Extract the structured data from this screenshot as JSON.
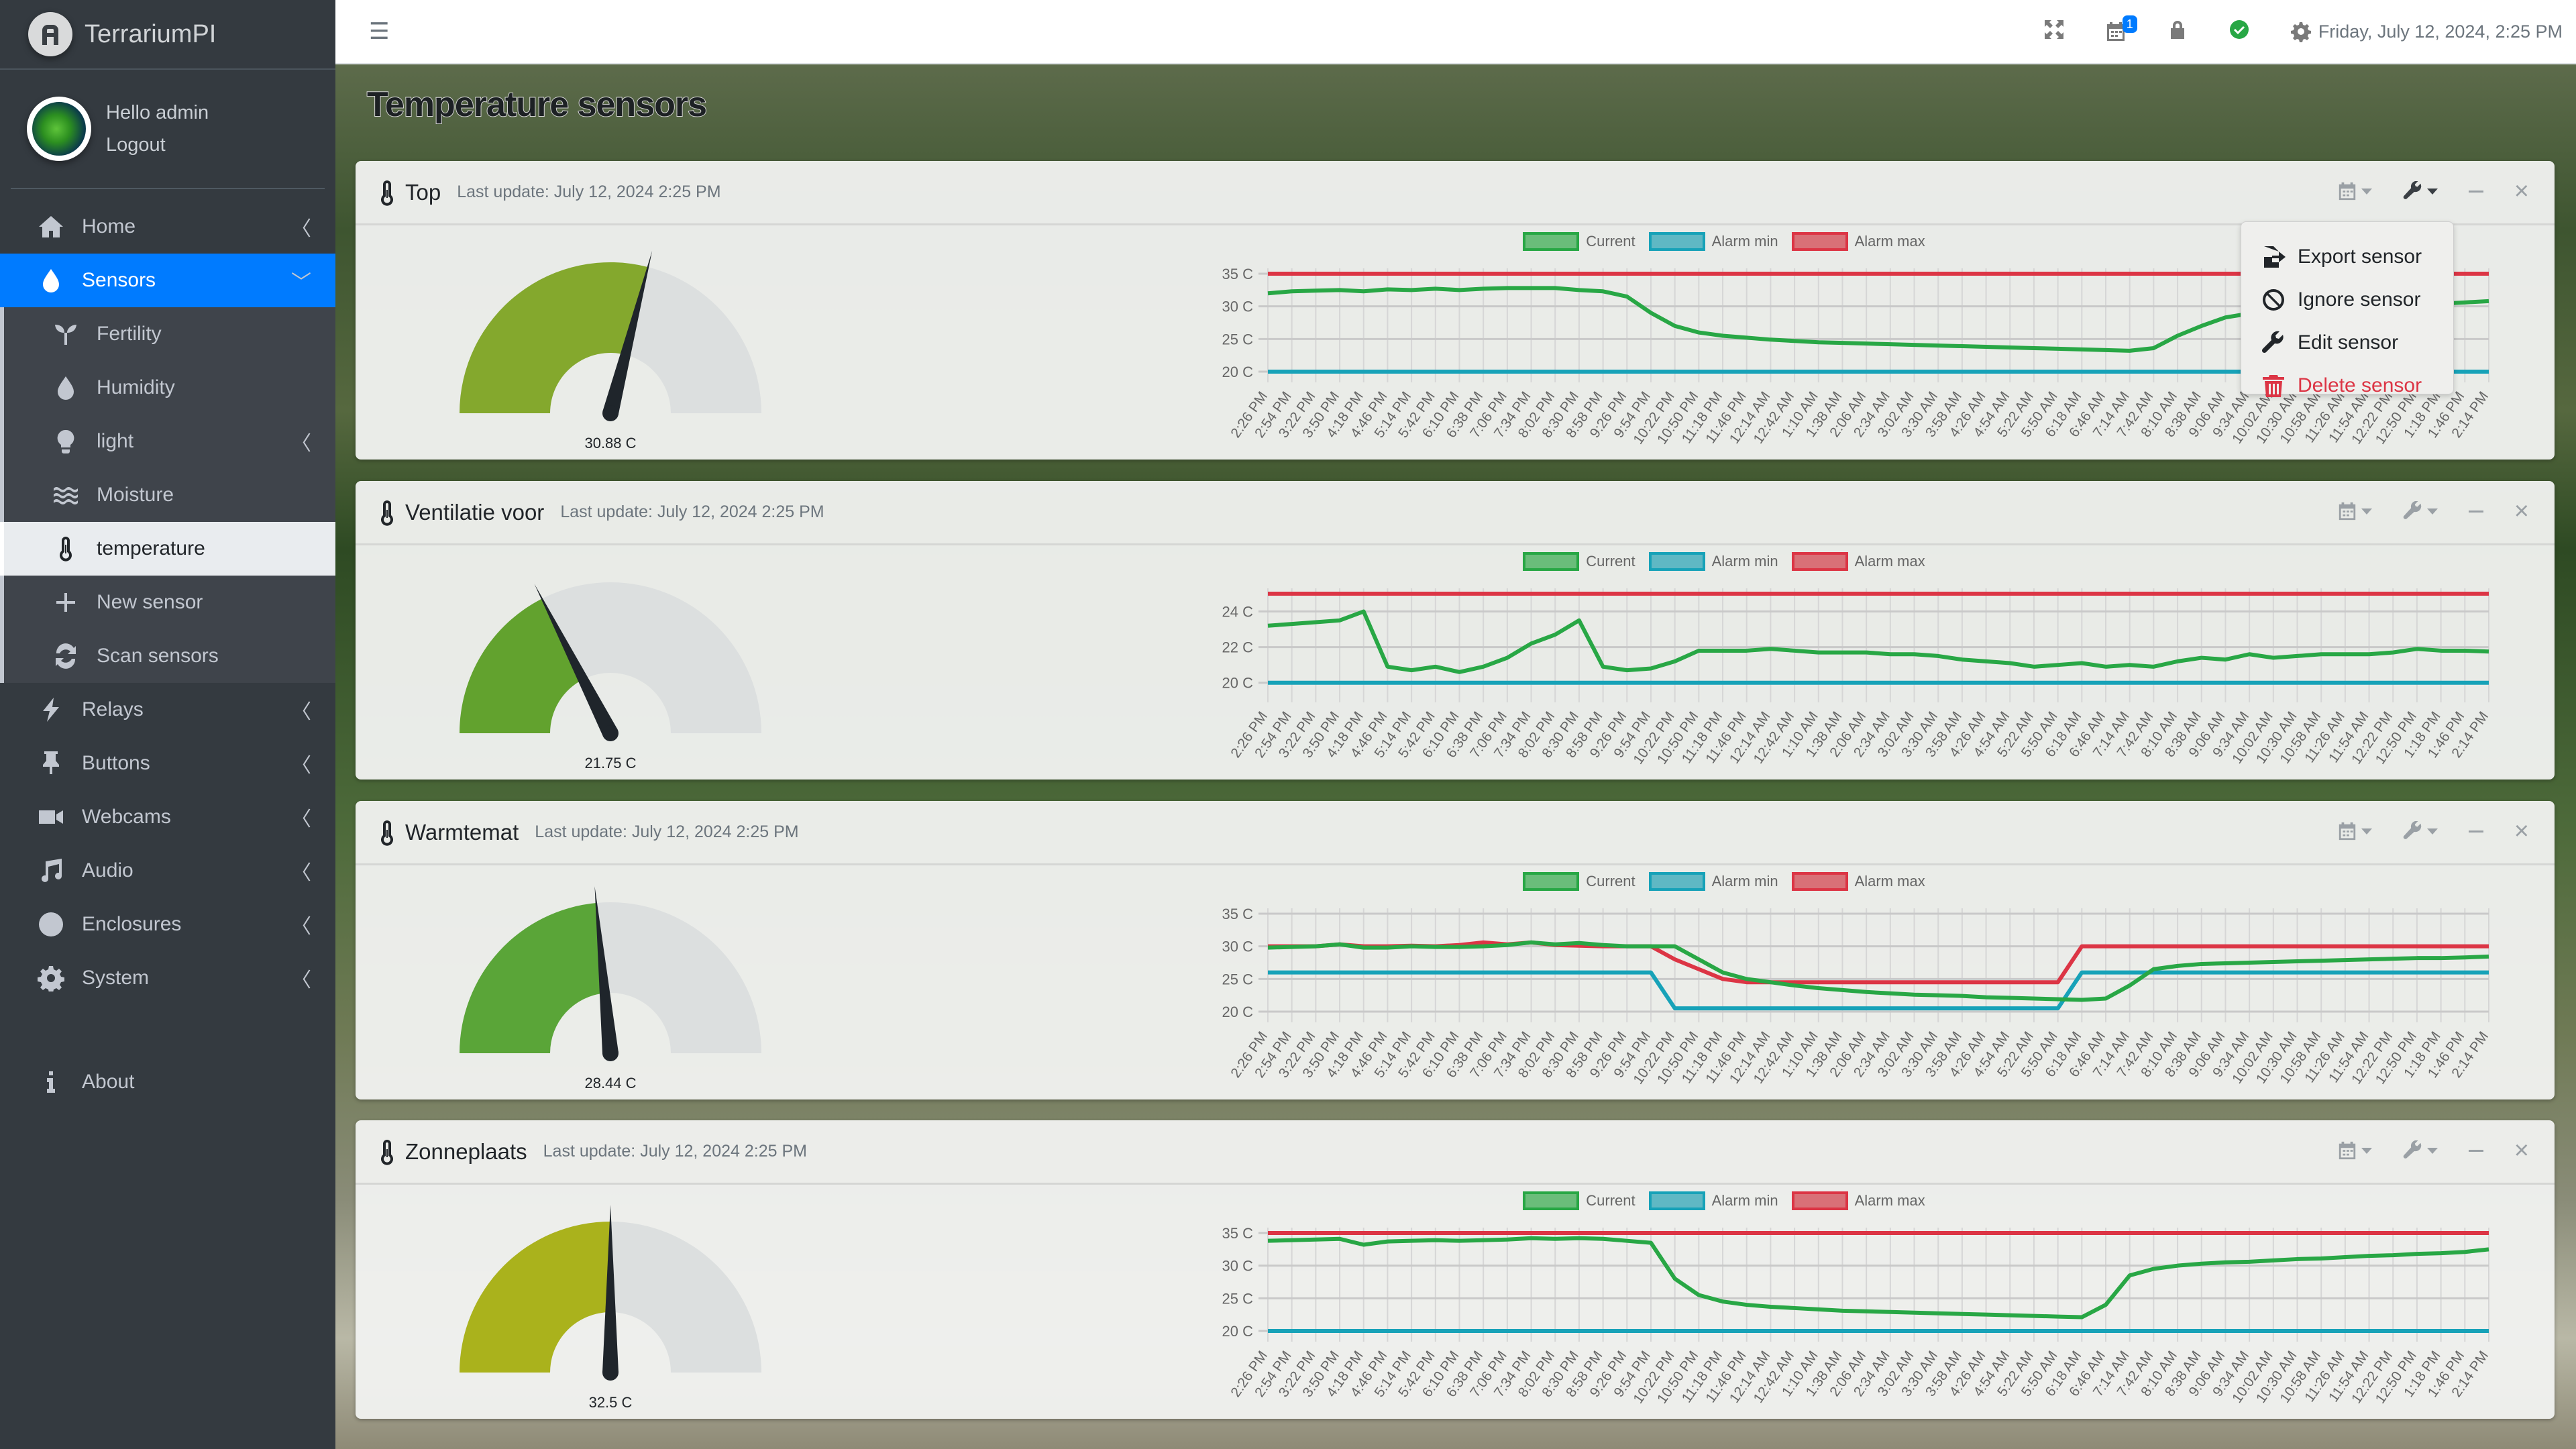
{
  "app": {
    "name": "TerrariumPI"
  },
  "user": {
    "greeting": "Hello admin",
    "logout": "Logout"
  },
  "sidebar": {
    "items": [
      {
        "label": "Home",
        "icon": "home-icon",
        "chevron": "‹"
      },
      {
        "label": "Sensors",
        "icon": "droplet-icon",
        "chevron": "⌄",
        "active": true
      },
      {
        "label": "Fertility",
        "icon": "seedling-icon",
        "sub": true
      },
      {
        "label": "Humidity",
        "icon": "droplet-icon",
        "sub": true
      },
      {
        "label": "light",
        "icon": "lightbulb-icon",
        "sub": true,
        "chevron": "‹"
      },
      {
        "label": "Moisture",
        "icon": "water-icon",
        "sub": true
      },
      {
        "label": "temperature",
        "icon": "thermometer-icon",
        "sub": true,
        "current": true
      },
      {
        "label": "New sensor",
        "icon": "plus-icon",
        "sub": true
      },
      {
        "label": "Scan sensors",
        "icon": "sync-icon",
        "sub": true
      },
      {
        "label": "Relays",
        "icon": "bolt-icon",
        "chevron": "‹"
      },
      {
        "label": "Buttons",
        "icon": "thumbtack-icon",
        "chevron": "‹"
      },
      {
        "label": "Webcams",
        "icon": "video-icon",
        "chevron": "‹"
      },
      {
        "label": "Audio",
        "icon": "music-icon",
        "chevron": "‹"
      },
      {
        "label": "Enclosures",
        "icon": "globe-icon",
        "chevron": "‹"
      },
      {
        "label": "System",
        "icon": "cog-icon",
        "chevron": "‹"
      },
      {
        "label": "About",
        "icon": "info-icon"
      }
    ]
  },
  "topbar": {
    "menu_icon": "bars-icon",
    "icons": [
      "expand-icon",
      "calendar-icon",
      "lock-icon",
      "check-circle-icon"
    ],
    "calendar_badge": "1",
    "datetime": "Friday, July 12, 2024, 2:25 PM"
  },
  "page": {
    "title": "Temperature sensors"
  },
  "legend": {
    "current": "Current",
    "alarm_min": "Alarm min",
    "alarm_max": "Alarm max"
  },
  "colors": {
    "current": "#28a745",
    "alarm_min": "#17a2b8",
    "alarm_max": "#dc3545",
    "sidebar_active": "#007bff"
  },
  "dropdown": {
    "items": [
      {
        "label": "Export sensor",
        "icon": "file-export-icon"
      },
      {
        "label": "Ignore sensor",
        "icon": "ban-icon"
      },
      {
        "label": "Edit sensor",
        "icon": "wrench-icon"
      },
      {
        "label": "Delete sensor",
        "icon": "trash-icon",
        "danger": true
      }
    ]
  },
  "x_labels": [
    "2:26 PM",
    "2:54 PM",
    "3:22 PM",
    "3:50 PM",
    "4:18 PM",
    "4:46 PM",
    "5:14 PM",
    "5:42 PM",
    "6:10 PM",
    "6:38 PM",
    "7:06 PM",
    "7:34 PM",
    "8:02 PM",
    "8:30 PM",
    "8:58 PM",
    "9:26 PM",
    "9:54 PM",
    "10:22 PM",
    "10:50 PM",
    "11:18 PM",
    "11:46 PM",
    "12:14 AM",
    "12:42 AM",
    "1:10 AM",
    "1:38 AM",
    "2:06 AM",
    "2:34 AM",
    "3:02 AM",
    "3:30 AM",
    "3:58 AM",
    "4:26 AM",
    "4:54 AM",
    "5:22 AM",
    "5:50 AM",
    "6:18 AM",
    "6:46 AM",
    "7:14 AM",
    "7:42 AM",
    "8:10 AM",
    "8:38 AM",
    "9:06 AM",
    "9:34 AM",
    "10:02 AM",
    "10:30 AM",
    "10:58 AM",
    "11:26 AM",
    "11:54 AM",
    "12:22 PM",
    "12:50 PM",
    "1:18 PM",
    "1:46 PM",
    "2:14 PM"
  ],
  "sensors": [
    {
      "name": "Top",
      "last_update": "Last update: July 12, 2024 2:25 PM",
      "value_label": "30.88 C",
      "gauge_fraction": 0.58,
      "gauge_color": "#84a82d",
      "y_ticks": [
        "35 C",
        "30 C",
        "25 C",
        "20 C"
      ],
      "y_range": [
        20,
        35
      ],
      "current": [
        32,
        32.3,
        32.4,
        32.5,
        32.3,
        32.6,
        32.5,
        32.7,
        32.5,
        32.7,
        32.8,
        32.8,
        32.8,
        32.5,
        32.3,
        31.5,
        29,
        27,
        26,
        25.5,
        25.2,
        24.9,
        24.7,
        24.5,
        24.4,
        24.3,
        24.2,
        24.1,
        24,
        23.9,
        23.8,
        23.7,
        23.6,
        23.5,
        23.4,
        23.3,
        23.2,
        23.6,
        25.5,
        27,
        28.3,
        28.9,
        29.3,
        29.5,
        29.7,
        29.8,
        30,
        30.2,
        30.3,
        30.4,
        30.6,
        30.8
      ],
      "alarm_min": 20,
      "alarm_max": 35,
      "show_menu": true
    },
    {
      "name": "Ventilatie voor",
      "last_update": "Last update: July 12, 2024 2:25 PM",
      "value_label": "21.75 C",
      "gauge_fraction": 0.35,
      "gauge_color": "#62a22e",
      "y_ticks": [
        "24 C",
        "22 C",
        "20 C"
      ],
      "y_range": [
        19.5,
        25
      ],
      "current": [
        23.2,
        23.3,
        23.4,
        23.5,
        24,
        20.9,
        20.7,
        20.9,
        20.6,
        20.9,
        21.4,
        22.2,
        22.7,
        23.5,
        20.9,
        20.7,
        20.8,
        21.2,
        21.8,
        21.8,
        21.8,
        21.9,
        21.8,
        21.7,
        21.7,
        21.7,
        21.6,
        21.6,
        21.5,
        21.3,
        21.2,
        21.1,
        20.9,
        21,
        21.1,
        20.9,
        21,
        20.9,
        21.2,
        21.4,
        21.3,
        21.6,
        21.4,
        21.5,
        21.6,
        21.6,
        21.6,
        21.7,
        21.9,
        21.8,
        21.8,
        21.75
      ],
      "alarm_min": 20,
      "alarm_max": 25
    },
    {
      "name": "Warmtemat",
      "last_update": "Last update: July 12, 2024 2:25 PM",
      "value_label": "28.44 C",
      "gauge_fraction": 0.47,
      "gauge_color": "#5aa538",
      "y_ticks": [
        "35 C",
        "30 C",
        "25 C",
        "20 C"
      ],
      "y_range": [
        20,
        35
      ],
      "current": [
        29.8,
        29.9,
        30,
        30.3,
        29.8,
        29.8,
        30,
        29.9,
        29.9,
        30,
        30.2,
        30.6,
        30.3,
        30.5,
        30.2,
        30,
        30,
        30,
        28,
        26,
        25,
        24.5,
        24,
        23.6,
        23.3,
        23,
        22.8,
        22.6,
        22.5,
        22.4,
        22.2,
        22.1,
        22,
        21.9,
        21.8,
        22,
        24,
        26.5,
        27,
        27.3,
        27.4,
        27.5,
        27.6,
        27.7,
        27.8,
        27.9,
        28,
        28.1,
        28.2,
        28.2,
        28.3,
        28.44
      ],
      "alarm_min_series": [
        26,
        26,
        26,
        26,
        26,
        26,
        26,
        26,
        26,
        26,
        26,
        26,
        26,
        26,
        26,
        26,
        26,
        20.5,
        20.5,
        20.5,
        20.5,
        20.5,
        20.5,
        20.5,
        20.5,
        20.5,
        20.5,
        20.5,
        20.5,
        20.5,
        20.5,
        20.5,
        20.5,
        20.5,
        26,
        26,
        26,
        26,
        26,
        26,
        26,
        26,
        26,
        26,
        26,
        26,
        26,
        26,
        26,
        26,
        26,
        26
      ],
      "alarm_max_series": [
        30,
        30,
        30,
        30.3,
        30,
        30,
        30.1,
        30,
        30.2,
        30.6,
        30.3,
        30.6,
        30.2,
        30.1,
        30,
        30,
        30,
        28,
        26.5,
        25,
        24.5,
        24.5,
        24.5,
        24.5,
        24.5,
        24.5,
        24.5,
        24.5,
        24.5,
        24.5,
        24.5,
        24.5,
        24.5,
        24.5,
        30,
        30,
        30,
        30,
        30,
        30,
        30,
        30,
        30,
        30,
        30,
        30,
        30,
        30,
        30,
        30,
        30,
        30
      ]
    },
    {
      "name": "Zonneplaats",
      "last_update": "Last update: July 12, 2024 2:25 PM",
      "value_label": "32.5 C",
      "gauge_fraction": 0.5,
      "gauge_color": "#aab21c",
      "y_ticks": [
        "35 C",
        "30 C",
        "25 C",
        "20 C"
      ],
      "y_range": [
        20,
        35
      ],
      "current": [
        33.8,
        33.9,
        34,
        34.1,
        33.2,
        33.7,
        33.8,
        33.9,
        33.8,
        33.9,
        34,
        34.2,
        34.1,
        34.2,
        34.1,
        33.8,
        33.5,
        28,
        25.5,
        24.5,
        24,
        23.7,
        23.5,
        23.3,
        23.1,
        23,
        22.9,
        22.8,
        22.7,
        22.6,
        22.5,
        22.4,
        22.3,
        22.2,
        22.1,
        24,
        28.5,
        29.5,
        30,
        30.3,
        30.5,
        30.6,
        30.8,
        31,
        31.1,
        31.3,
        31.5,
        31.6,
        31.8,
        31.9,
        32.1,
        32.5
      ],
      "alarm_min": 20,
      "alarm_max": 35
    }
  ]
}
